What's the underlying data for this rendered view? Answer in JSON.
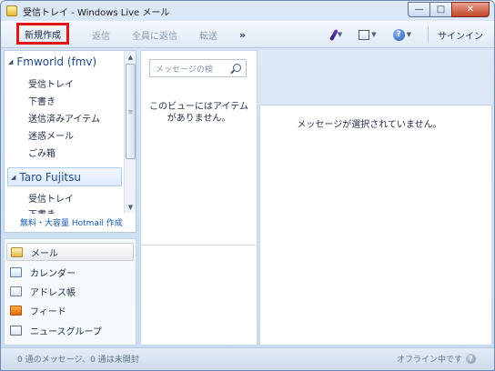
{
  "window": {
    "title": "受信トレイ - Windows Live メール",
    "minimize": "—",
    "maximize": "□",
    "close": "✕"
  },
  "toolbar": {
    "new": "新規作成",
    "reply": "返信",
    "reply_all": "全員に返信",
    "forward": "転送",
    "more": "»",
    "signin": "サインイン"
  },
  "folders": {
    "account1": "Fmworld (fmv)",
    "account1_items": [
      "受信トレイ",
      "下書き",
      "送信済みアイテム",
      "迷惑メール",
      "ごみ箱"
    ],
    "account2": "Taro Fujitsu",
    "account2_items": [
      "受信トレイ",
      "下書き"
    ],
    "hotmail_link": "無料・大容量 Hotmail 作成"
  },
  "nav": {
    "items": [
      "メール",
      "カレンダー",
      "アドレス帳",
      "フィード",
      "ニュースグループ"
    ]
  },
  "list": {
    "search_placeholder": "メッセージの検",
    "empty_line1": "このビューにはアイテム",
    "empty_line2": "がありません。"
  },
  "reader": {
    "no_selection": "メッセージが選択されていません。"
  },
  "status": {
    "left": "0 通のメッセージ、0 通は未開封",
    "right": "オフライン中です"
  }
}
